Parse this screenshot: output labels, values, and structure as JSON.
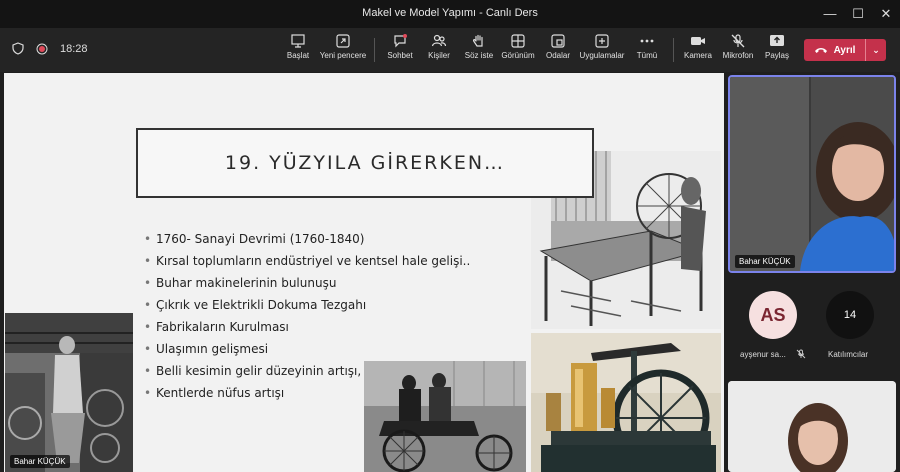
{
  "window": {
    "title": "Makel ve Model Yapımı - Canlı Ders"
  },
  "toolbar": {
    "time": "18:28",
    "buttons": [
      {
        "label": "Başlat"
      },
      {
        "label": "Yeni pencere"
      },
      {
        "label": "Sohbet"
      },
      {
        "label": "Kişiler"
      },
      {
        "label": "Söz iste"
      },
      {
        "label": "Görünüm"
      },
      {
        "label": "Odalar"
      },
      {
        "label": "Uygulamalar"
      },
      {
        "label": "Tümü"
      },
      {
        "label": "Kamera"
      },
      {
        "label": "Mikrofon"
      },
      {
        "label": "Paylaş"
      }
    ],
    "leave_label": "Ayrıl"
  },
  "slide": {
    "title": "19. YÜZYILA GİRERKEN…",
    "bullets": [
      "1760- Sanayi Devrimi (1760-1840)",
      "Kırsal toplumların endüstriyel ve kentsel hale gelişi..",
      "Buhar makinelerinin bulunuşu",
      "Çıkrık ve Elektrikli Dokuma Tezgahı",
      "Fabrikaların Kurulması",
      "Ulaşımın gelişmesi",
      "Belli kesimin gelir düzeyinin artışı,",
      "Kentlerde nüfus artışı"
    ],
    "presenter_tag": "Bahar KÜÇÜK"
  },
  "participants": {
    "main_video_name": "Bahar KÜÇÜK",
    "avatar_initials": "AS",
    "avatar_name": "ayşenur sa...",
    "count": "14",
    "count_label": "Katılımcılar"
  },
  "colors": {
    "accent": "#7b83eb",
    "leave": "#c4314b",
    "toolbar": "#242424"
  }
}
